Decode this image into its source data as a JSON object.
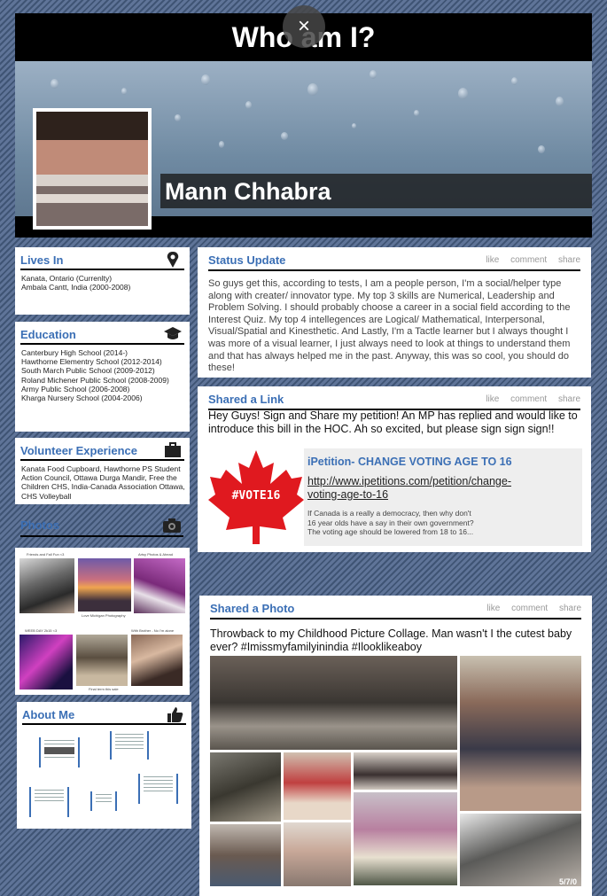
{
  "header": {
    "title": "Who am I?",
    "close_symbol": "×"
  },
  "profile": {
    "name": "Mann Chhabra"
  },
  "lives_in": {
    "title": "Lives In",
    "icon": "map-pin-icon",
    "items": [
      "Kanata, Ontario (Currenlty)",
      "Ambala Cantt, India (2000-2008)"
    ]
  },
  "education": {
    "title": "Education",
    "icon": "graduation-cap-icon",
    "items": [
      "Canterbury High School (2014-)",
      "Hawthorne Elementry School (2012-2014)",
      "South March Public School (2009-2012)",
      "Roland Michener Public School (2008-2009)",
      "Army Public School (2006-2008)",
      "Kharga Nursery School (2004-2006)"
    ]
  },
  "volunteer": {
    "title": "Volunteer Experience",
    "icon": "briefcase-icon",
    "text": "Kanata Food Cupboard, Hawthorne PS Student Action Council, Ottawa Durga Mandir, Free the Children CHS, India-Canada Association Ottawa, CHS Volleyball"
  },
  "photos": {
    "title": "Photos",
    "icon": "camera-icon",
    "captions": [
      "Friends and Fall Fun <3",
      "Artsy Photos & Ahead",
      "Love Michigan Photography",
      "WEEB DAY 2k15 <3",
      "With Brother - No I'm alone",
      "Final term this sale"
    ]
  },
  "about": {
    "title": "About Me",
    "icon": "thumbs-up-icon"
  },
  "actions": {
    "like": "like",
    "comment": "comment",
    "share": "share"
  },
  "status": {
    "title": "Status Update",
    "body": "So guys get this, according to tests, I am a people person, I'm a social/helper type along with creater/ innovator type. My top 3 skills are Numerical, Leadership and Problem Solving. I should probably choose a career in a social field according to the Interest Quiz. My top 4 intellegences are Logical/ Mathematical, Interpersonal, Visual/Spatial and Kinesthetic. And Lastly, I'm a Tactle learner but I always thought I was more of a visual learner, I just always need to look at things to understand them and that has always helped me in the past. Anyway, this was so cool, you should do these!"
  },
  "shared_link": {
    "title": "Shared a Link",
    "text": "Hey Guys! Sign and Share my petition! An MP has replied and would like to introduce this bill in the HOC. Ah so excited, but please sign sign sign!!",
    "preview_title": "iPetition- CHANGE VOTING AGE TO 16",
    "url": "http://www.ipetitions.com/petition/change-voting-age-to-16",
    "description": "If Canada is a really a democracy, then why don't 16 year olds have a say in their own government? The voting age should be lowered from 18 to 16...",
    "flag_text": "#VOTE16"
  },
  "shared_photo": {
    "title": "Shared a Photo",
    "text": "Throwback to my Childhood Picture Collage. Man wasn't I the cutest baby ever? #Imissmyfamilyinindia #Ilooklikeaboy",
    "stamp": "5/7/0"
  },
  "colors": {
    "accent": "#3b6fb5",
    "title_bar": "#000000",
    "card": "#ffffff"
  }
}
